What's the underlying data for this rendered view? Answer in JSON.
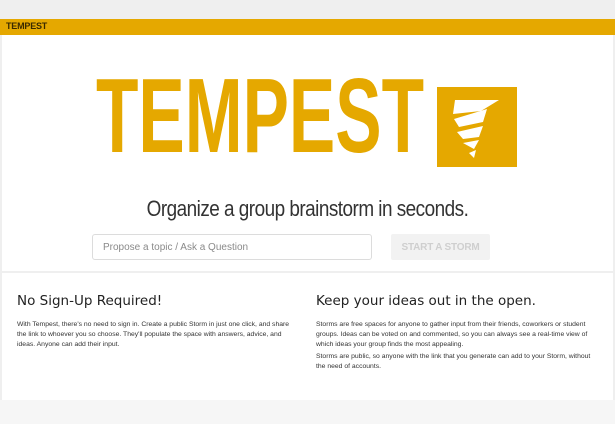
{
  "app": {
    "title": "TEMPEST"
  },
  "brand": {
    "logo_text": "TEMPEST",
    "color": "#e5a800"
  },
  "hero": {
    "tagline": "Organize a group brainstorm in seconds.",
    "search_placeholder": "Propose a topic / Ask a Question",
    "search_value": "",
    "start_button_label": "START A STORM"
  },
  "features": [
    {
      "title": "No Sign-Up Required!",
      "paragraphs": [
        "With Tempest, there's no need to sign in. Create a public Storm in just one click, and share the link to whoever you so choose. They'll populate the space with answers, advice, and ideas. Anyone can add their input."
      ]
    },
    {
      "title": "Keep your ideas out in the open.",
      "paragraphs": [
        "Storms are free spaces for anyone to gather input from their friends, coworkers or student groups. Ideas can be voted on and commented, so you can always see a real-time view of which ideas your group finds the most appealing.",
        "Storms are public, so anyone with the link that you generate can add to your Storm, without the need of accounts."
      ]
    }
  ]
}
